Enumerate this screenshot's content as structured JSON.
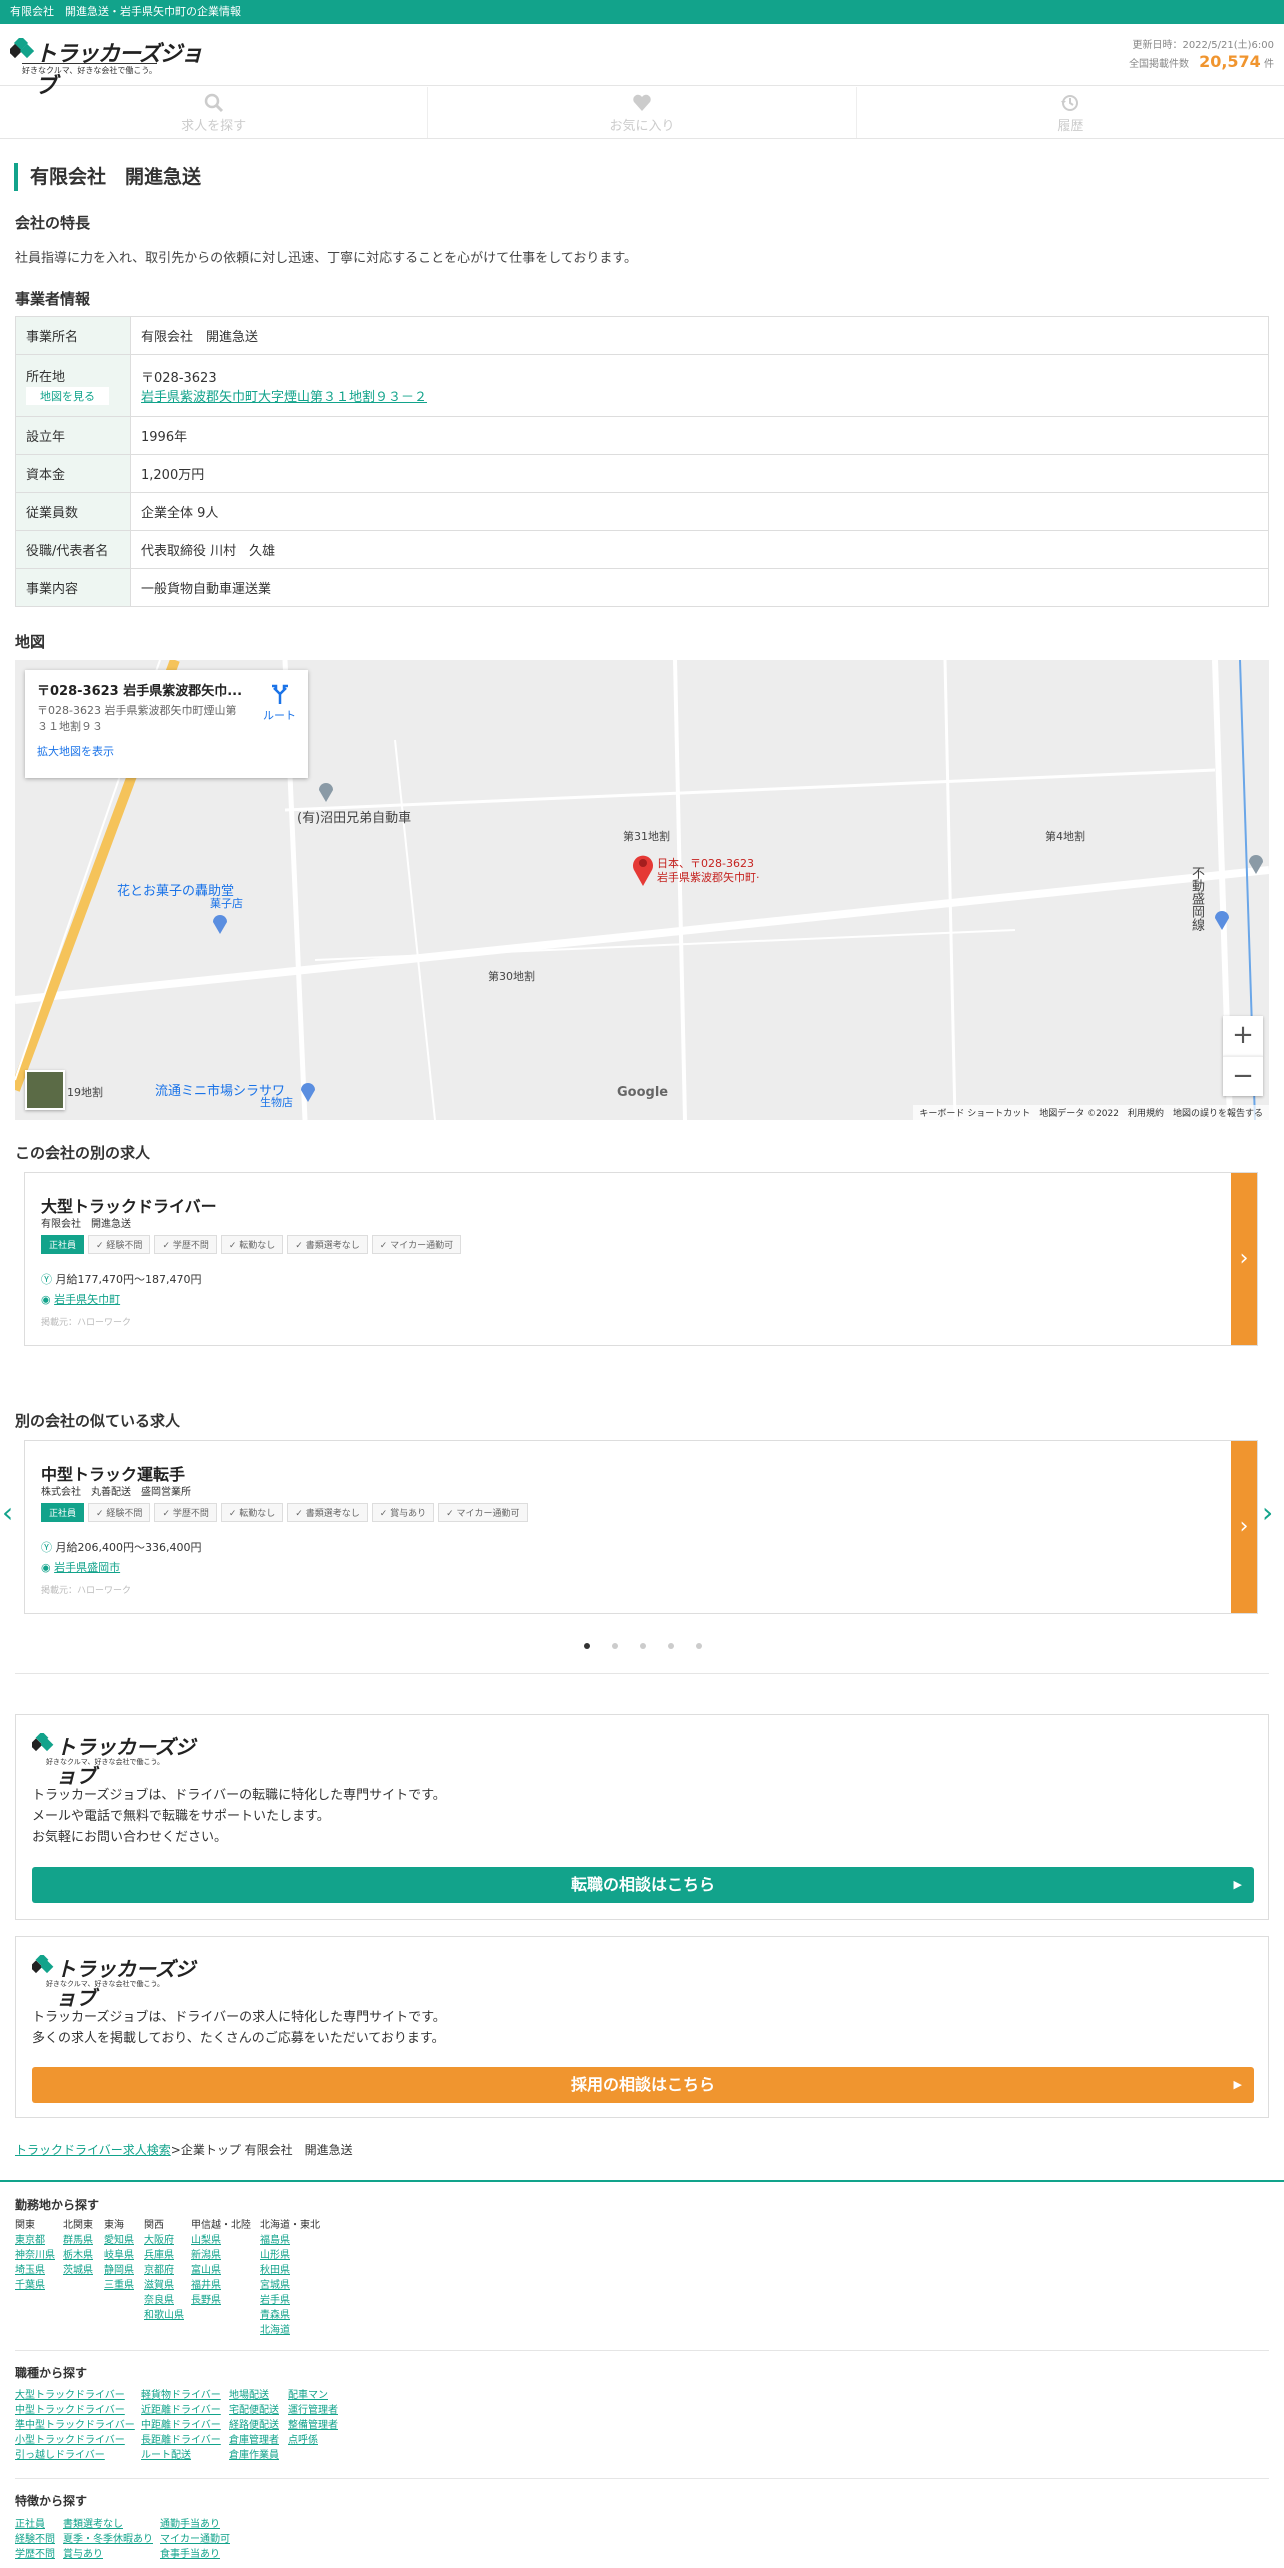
{
  "topbar": {
    "text": "有限会社　開進急送・岩手県矢巾町の企業情報"
  },
  "header": {
    "logo_text": "トラッカーズジョブ",
    "logo_sub": "好きなクルマ、好きな会社で働こう。",
    "updated": "更新日時：2022/5/21(土)6:00",
    "count_label": "全国掲載件数",
    "count": "20,574",
    "count_unit": "件"
  },
  "nav": [
    {
      "label": "求人を探す",
      "icon": "search-icon"
    },
    {
      "label": "お気に入り",
      "icon": "heart-icon"
    },
    {
      "label": "履歴",
      "icon": "history-icon"
    }
  ],
  "page_title": "有限会社　開進急送",
  "feature": {
    "heading": "会社の特長",
    "text": "社員指導に力を入れ、取引先からの依頼に対し迅速、丁寧に対応することを心がけて仕事をしております。"
  },
  "info": {
    "heading": "事業者情報",
    "rows": {
      "name_label": "事業所名",
      "name": "有限会社　開進急送",
      "addr_label": "所在地",
      "map_btn": "地図を見る",
      "zip": "〒028-3623",
      "addr": "岩手県紫波郡矢巾町大字煙山第３１地割９３－２",
      "est_label": "設立年",
      "est": "1996年",
      "cap_label": "資本金",
      "cap": "1,200万円",
      "emp_label": "従業員数",
      "emp": "企業全体 9人",
      "rep_label": "役職/代表者名",
      "rep": "代表取締役 川村　久雄",
      "biz_label": "事業内容",
      "biz": "一般貨物自動車運送業"
    }
  },
  "map": {
    "heading": "地図",
    "card_title": "〒028-3623 岩手県紫波郡矢巾...",
    "card_addr": "〒028-3623 岩手県紫波郡矢巾町煙山第３１地割９３",
    "card_link": "拡大地図を表示",
    "route": "ルート",
    "pin_label_1": "日本、〒028-3623",
    "pin_label_2": "岩手県紫波郡矢巾町·",
    "labels": [
      "(有)沼田兄弟自動車",
      "第31地割",
      "第4地割",
      "花とお菓子の轟助堂",
      "菓子店",
      "第30地割",
      "流通ミニ市場シラサワ",
      "生物店",
      "19地割",
      "不動盛岡線"
    ],
    "google": "Google",
    "footer": "キーボード ショートカット　地図データ ©2022　利用規約　地図の誤りを報告する"
  },
  "other_jobs": {
    "heading": "この会社の別の求人",
    "job": {
      "title": "大型トラックドライバー",
      "company": "有限会社　開進急送",
      "tags": [
        "正社員",
        "経験不問",
        "学歴不問",
        "転勤なし",
        "書類選考なし",
        "マイカー通勤可"
      ],
      "salary": "月給177,470円〜187,470円",
      "location": "岩手県矢巾町",
      "source": "掲載元：ハローワーク"
    }
  },
  "similar_jobs": {
    "heading": "別の会社の似ている求人",
    "job": {
      "title": "中型トラック運転手",
      "company": "株式会社　丸善配送　盛岡営業所",
      "tags": [
        "正社員",
        "経験不問",
        "学歴不問",
        "転勤なし",
        "書類選考なし",
        "賞与あり",
        "マイカー通勤可"
      ],
      "salary": "月給206,400円〜336,400円",
      "location": "岩手県盛岡市",
      "source": "掲載元：ハローワーク"
    }
  },
  "cta1": {
    "text1": "トラッカーズジョブは、ドライバーの転職に特化した専門サイトです。",
    "text2": "メールや電話で無料で転職をサポートいたします。",
    "text3": "お気軽にお問い合わせください。",
    "button": "転職の相談はこちら",
    "color": "#12a38b"
  },
  "cta2": {
    "text1": "トラッカーズジョブは、ドライバーの求人に特化した専門サイトです。",
    "text2": "多くの求人を掲載しており、たくさんのご応募をいただいております。",
    "button": "採用の相談はこちら",
    "color": "#f0952f"
  },
  "breadcrumb": {
    "link": "トラックドライバー求人検索",
    "sep": ">",
    "rest": "企業トップ 有限会社　開進急送"
  },
  "footer": {
    "area_heading": "勤務地から探す",
    "areas": [
      {
        "region": "関東",
        "items": [
          "東京都",
          "神奈川県",
          "埼玉県",
          "千葉県"
        ]
      },
      {
        "region": "北関東",
        "items": [
          "群馬県",
          "栃木県",
          "茨城県"
        ]
      },
      {
        "region": "東海",
        "items": [
          "愛知県",
          "岐阜県",
          "静岡県",
          "三重県"
        ]
      },
      {
        "region": "関西",
        "items": [
          "大阪府",
          "兵庫県",
          "京都府",
          "滋賀県",
          "奈良県",
          "和歌山県"
        ]
      },
      {
        "region": "甲信越・北陸",
        "items": [
          "山梨県",
          "新潟県",
          "富山県",
          "福井県",
          "長野県"
        ]
      },
      {
        "region": "北海道・東北",
        "items": [
          "福島県",
          "山形県",
          "秋田県",
          "宮城県",
          "岩手県",
          "青森県",
          "北海道"
        ]
      }
    ],
    "type_heading": "職種から探す",
    "types": [
      [
        "大型トラックドライバー",
        "中型トラックドライバー",
        "準中型トラックドライバー",
        "小型トラックドライバー",
        "引っ越しドライバー"
      ],
      [
        "軽貨物ドライバー",
        "近距離ドライバー",
        "中距離ドライバー",
        "長距離ドライバー",
        "ルート配送"
      ],
      [
        "地場配送",
        "宅配便配送",
        "経路便配送",
        "倉庫管理者",
        "倉庫作業員"
      ],
      [
        "配車マン",
        "運行管理者",
        "整備管理者",
        "点呼係"
      ]
    ],
    "feat_heading": "特徴から探す",
    "feats": [
      [
        "正社員",
        "経験不問",
        "学歴不問"
      ],
      [
        "書類選考なし",
        "夏季・冬季休暇あり",
        "賞与あり"
      ],
      [
        "通勤手当あり",
        "マイカー通勤可",
        "食事手当あり"
      ]
    ]
  }
}
